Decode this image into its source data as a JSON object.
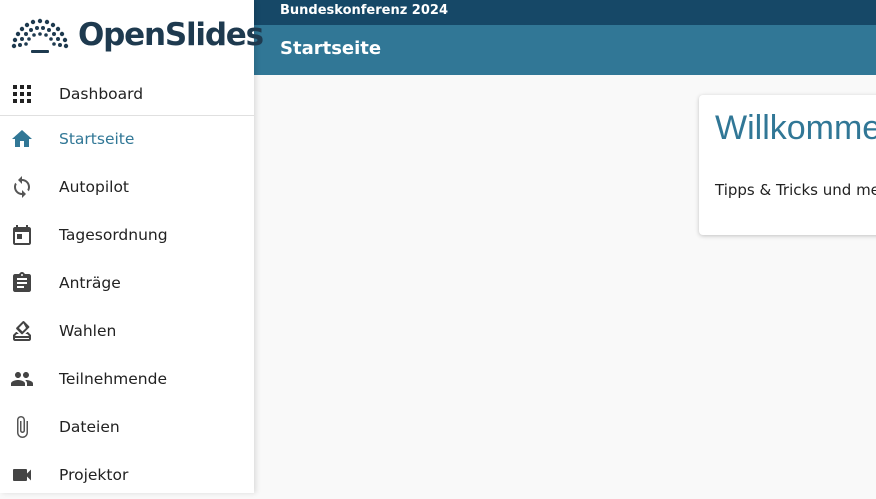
{
  "app": {
    "name": "OpenSlides"
  },
  "header": {
    "meeting_name": "Bundeskonferenz 2024",
    "page_title": "Startseite"
  },
  "sidebar": {
    "items": [
      {
        "label": "Dashboard",
        "icon": "apps-grid-icon"
      },
      {
        "label": "Startseite",
        "icon": "home-icon",
        "active": true
      },
      {
        "label": "Autopilot",
        "icon": "sync-icon"
      },
      {
        "label": "Tagesordnung",
        "icon": "calendar-icon"
      },
      {
        "label": "Anträge",
        "icon": "clipboard-icon"
      },
      {
        "label": "Wahlen",
        "icon": "ballot-icon"
      },
      {
        "label": "Teilnehmende",
        "icon": "people-icon"
      },
      {
        "label": "Dateien",
        "icon": "paperclip-icon"
      },
      {
        "label": "Projektor",
        "icon": "videocam-icon"
      }
    ]
  },
  "main": {
    "welcome_title": "Willkommen",
    "welcome_text": "Tipps & Tricks und me"
  },
  "colors": {
    "topbar": "#164867",
    "titlebar": "#317796",
    "accent": "#317796",
    "logo_text": "#1e3a4f"
  }
}
